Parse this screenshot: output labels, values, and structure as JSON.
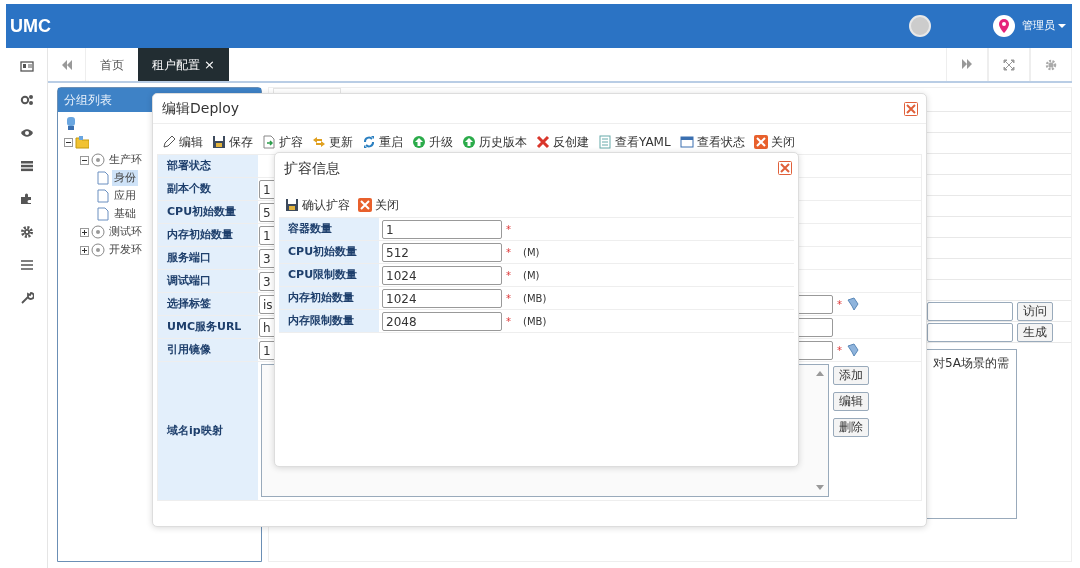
{
  "app": {
    "logo": "UMC",
    "user_menu": "管理员"
  },
  "tabs": [
    {
      "label": "首页",
      "selected": false
    },
    {
      "label": "租户配置",
      "selected": true,
      "close": "×"
    }
  ],
  "group_panel": {
    "title": "分组列表",
    "tree": [
      {
        "kind": "server",
        "children": [
          {
            "kind": "folder",
            "expanded": true,
            "children": [
              {
                "kind": "env",
                "label": "生产环",
                "expanded": true,
                "children": [
                  {
                    "kind": "page",
                    "label": "身份",
                    "selected": true
                  },
                  {
                    "kind": "page",
                    "label": "应用",
                    "selected": false
                  },
                  {
                    "kind": "page",
                    "label": "基础",
                    "selected": false
                  }
                ]
              },
              {
                "kind": "env",
                "label": "测试环",
                "expanded": false
              },
              {
                "kind": "env",
                "label": "开发环",
                "expanded": false
              }
            ]
          }
        ]
      }
    ]
  },
  "background_form": {
    "fields": [
      {
        "button": "访问"
      },
      {
        "button": "生成"
      }
    ],
    "notes": "对5A场景的需"
  },
  "deploy_dialog": {
    "title": "编辑Deploy",
    "toolbar": [
      {
        "kind": "edit",
        "label": "编辑"
      },
      {
        "kind": "save",
        "label": "保存"
      },
      {
        "kind": "scale",
        "label": "扩容"
      },
      {
        "kind": "update",
        "label": "更新"
      },
      {
        "kind": "restart",
        "label": "重启"
      },
      {
        "kind": "upgrade",
        "label": "升级"
      },
      {
        "kind": "history",
        "label": "历史版本"
      },
      {
        "kind": "uncreate",
        "label": "反创建"
      },
      {
        "kind": "yaml",
        "label": "查看YAML"
      },
      {
        "kind": "status",
        "label": "查看状态"
      },
      {
        "kind": "close",
        "label": "关闭"
      }
    ],
    "fields": [
      {
        "label": "部署状态"
      },
      {
        "label": "副本个数",
        "value": "1"
      },
      {
        "label": "CPU初始数量",
        "value": "5"
      },
      {
        "label": "内存初始数量",
        "value": "1"
      },
      {
        "label": "服务端口",
        "value": "3"
      },
      {
        "label": "调试端口",
        "value": "3"
      },
      {
        "label": "选择标签",
        "value": "is",
        "mark": "*",
        "picker": true
      },
      {
        "label": "UMC服务URL",
        "value": "h"
      },
      {
        "label": "引用镜像",
        "value": "1",
        "mark": "*",
        "picker": true
      }
    ],
    "mapping": {
      "label": "域名ip映射",
      "buttons": [
        "添加",
        "编辑",
        "删除"
      ]
    }
  },
  "scale_dialog": {
    "title": "扩容信息",
    "toolbar": [
      {
        "kind": "save",
        "label": "确认扩容"
      },
      {
        "kind": "close",
        "label": "关闭"
      }
    ],
    "fields": [
      {
        "label": "容器数量",
        "value": "1",
        "mark": "*"
      },
      {
        "label": "CPU初始数量",
        "value": "512",
        "mark": "*",
        "unit": "(M)"
      },
      {
        "label": "CPU限制数量",
        "value": "1024",
        "mark": "*",
        "unit": "(M)"
      },
      {
        "label": "内存初始数量",
        "value": "1024",
        "mark": "*",
        "unit": "(MB)"
      },
      {
        "label": "内存限制数量",
        "value": "2048",
        "mark": "*",
        "unit": "(MB)"
      }
    ]
  }
}
